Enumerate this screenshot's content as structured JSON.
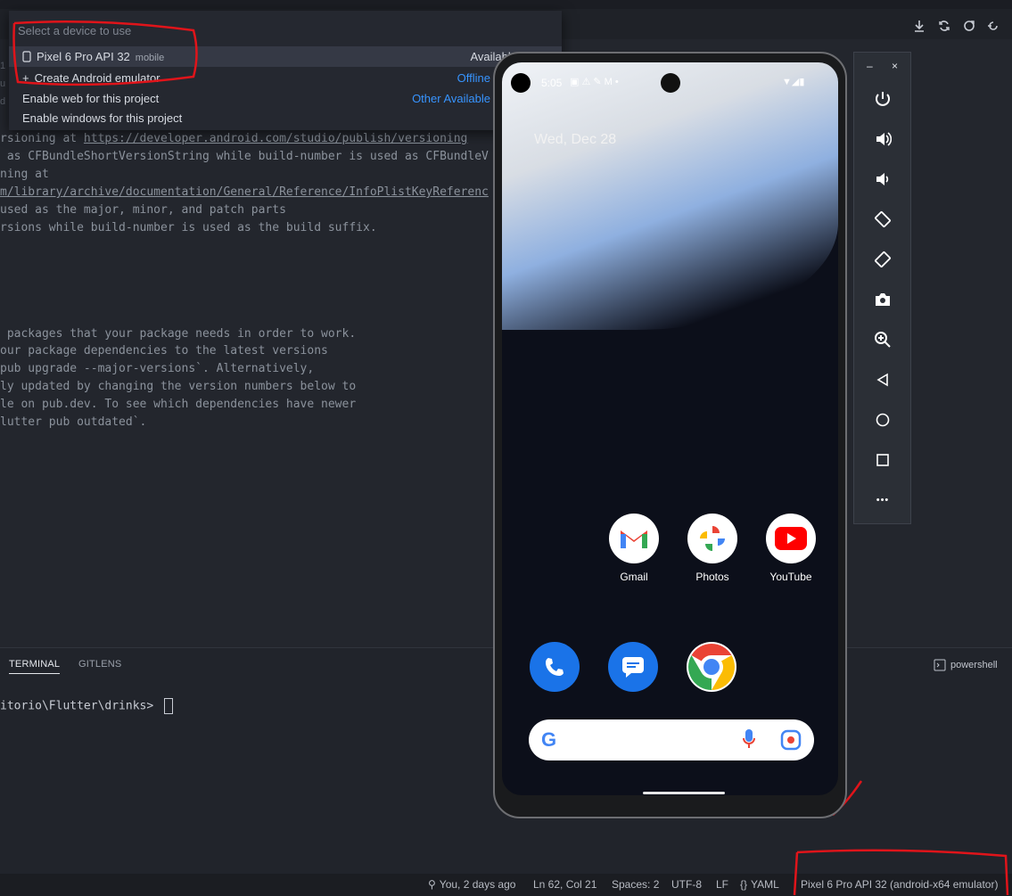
{
  "picker": {
    "placeholder": "Select a device to use",
    "rows": [
      {
        "label": "Pixel 6 Pro API 32",
        "sub": "mobile",
        "status": "Available"
      },
      {
        "label": "Create Android emulator",
        "status": "Offline"
      },
      {
        "label": "Enable web for this project",
        "status": "Other Available"
      },
      {
        "label": "Enable windows for this project",
        "status": ""
      }
    ]
  },
  "editor": {
    "lines": [
      "rsioning at ",
      " as CFBundleShortVersionString while build-number is used as CFBundleV",
      "ning at",
      "m/library/archive/documentation/General/Reference/InfoPlistKeyReferenc",
      "used as the major, minor, and patch parts",
      "rsions while build-number is used as the build suffix.",
      " packages that your package needs in order to work.",
      "our package dependencies to the latest versions",
      "pub upgrade --major-versions`. Alternatively,",
      "ly updated by changing the version numbers below to",
      "le on pub.dev. To see which dependencies have newer",
      "lutter pub outdated`."
    ],
    "link": "https://developer.android.com/studio/publish/versioning"
  },
  "panel": {
    "tabs": [
      "TERMINAL",
      "GITLENS"
    ],
    "shell": "powershell",
    "terminal_prompt": "itorio\\Flutter\\drinks> "
  },
  "statusbar": {
    "blame": "You, 2 days ago",
    "position": "Ln 62, Col 21",
    "spaces": "Spaces: 2",
    "encoding": "UTF-8",
    "eol": "LF",
    "language": "YAML",
    "device": "Pixel 6 Pro API 32 (android-x64 emulator)"
  },
  "phone": {
    "time": "5:05",
    "date": "Wed, Dec 28",
    "apps_row1": [
      "Gmail",
      "Photos",
      "YouTube"
    ]
  },
  "emulator": {
    "minimize": "–",
    "close": "×",
    "more": "•••"
  }
}
